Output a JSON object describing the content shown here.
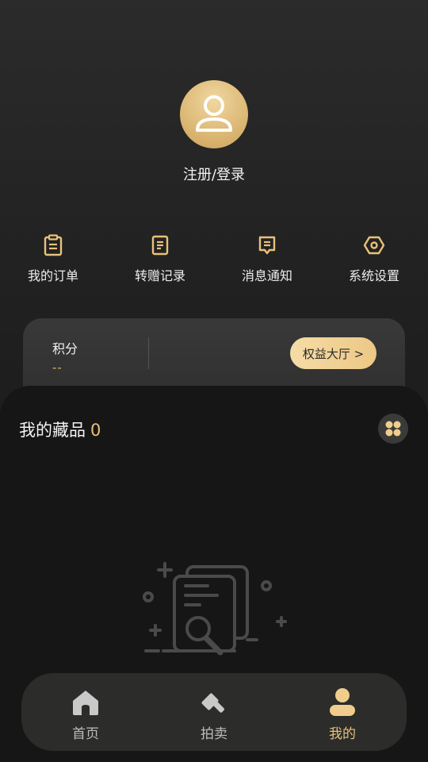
{
  "profile": {
    "login_text": "注册/登录",
    "avatar_icon": "user-icon"
  },
  "menu": {
    "items": [
      {
        "label": "我的订单",
        "icon": "clipboard-icon"
      },
      {
        "label": "转赠记录",
        "icon": "document-icon"
      },
      {
        "label": "消息通知",
        "icon": "message-icon"
      },
      {
        "label": "系统设置",
        "icon": "settings-icon"
      }
    ]
  },
  "points_card": {
    "title": "积分",
    "value": "--",
    "button_label": "权益大厅 >"
  },
  "collection": {
    "title": "我的藏品",
    "count": "0"
  },
  "nav": {
    "items": [
      {
        "label": "首页",
        "icon": "home-icon",
        "active": false
      },
      {
        "label": "拍卖",
        "icon": "auction-hammer-icon",
        "active": false
      },
      {
        "label": "我的",
        "icon": "profile-icon",
        "active": true
      }
    ]
  },
  "colors": {
    "accent": "#e8c17a",
    "avatar_gold": "#d8b26d",
    "background": "#1f1f1f"
  }
}
